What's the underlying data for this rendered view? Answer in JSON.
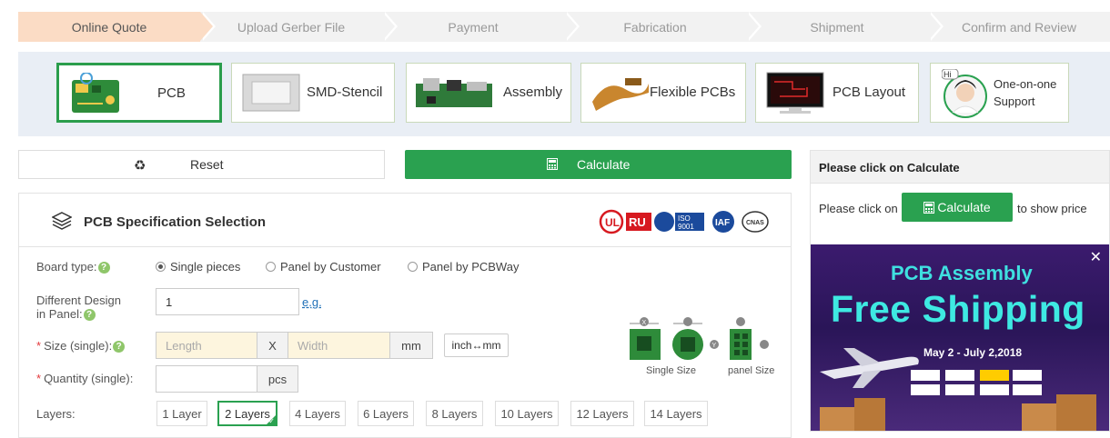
{
  "steps": [
    "Online Quote",
    "Upload Gerber File",
    "Payment",
    "Fabrication",
    "Shipment",
    "Confirm and Review"
  ],
  "products": [
    {
      "label": "PCB",
      "icon": "pcb-board-icon"
    },
    {
      "label": "SMD-Stencil",
      "icon": "stencil-icon"
    },
    {
      "label": "Assembly",
      "icon": "assembly-board-icon"
    },
    {
      "label": "Flexible PCBs",
      "icon": "flex-pcb-icon"
    },
    {
      "label": "PCB Layout",
      "icon": "monitor-layout-icon"
    },
    {
      "label_line1": "One-on-one",
      "label_line2": "Support",
      "badge": "Hi",
      "icon": "support-avatar-icon"
    }
  ],
  "actions": {
    "reset_label": "Reset",
    "calculate_label": "Calculate"
  },
  "spec": {
    "title": "PCB Specification Selection",
    "certs": [
      "UL",
      "ISO 9001",
      "IAF",
      "CNAS"
    ],
    "board_type": {
      "label": "Board type:",
      "options": [
        "Single pieces",
        "Panel by Customer",
        "Panel by PCBWay"
      ],
      "selected": "Single pieces"
    },
    "different_design": {
      "label_line1": "Different Design",
      "label_line2": "in Panel:",
      "value": "1",
      "example_link": "e.g."
    },
    "size": {
      "label": "Size (single):",
      "length_placeholder": "Length",
      "separator": "X",
      "width_placeholder": "Width",
      "unit": "mm",
      "toggle_label": "inch↔mm"
    },
    "quantity": {
      "label": "Quantity (single):",
      "unit": "pcs"
    },
    "layers": {
      "label": "Layers:",
      "options": [
        "1 Layer",
        "2 Layers",
        "4 Layers",
        "6 Layers",
        "8 Layers",
        "10 Layers",
        "12 Layers",
        "14 Layers"
      ],
      "selected": "2 Layers"
    },
    "diagram": {
      "single_caption": "Single Size",
      "panel_caption": "panel Size",
      "x_mark": "X",
      "y_mark": "Y"
    }
  },
  "sidebar": {
    "heading": "Please click on Calculate",
    "prompt_before": "Please click on",
    "button_label": "Calculate",
    "prompt_after": "to show price",
    "promo": {
      "line1": "PCB Assembly",
      "line2": "Free Shipping",
      "dates": "May 2 - July 2,2018"
    }
  },
  "colors": {
    "primary_green": "#2aa150",
    "active_step": "#fbdcc5",
    "band": "#e9eef5"
  }
}
